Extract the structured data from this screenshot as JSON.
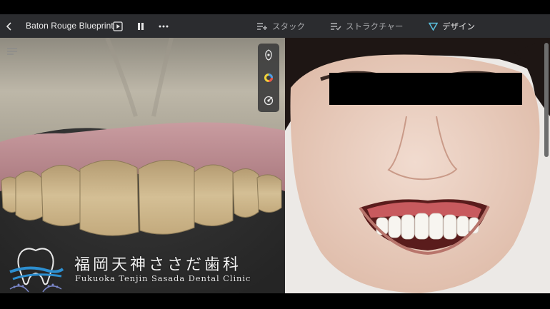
{
  "header": {
    "title": "Baton Rouge Blueprint",
    "back_icon": "chevron-left-icon",
    "play_icon": "play-square-icon",
    "pause_icon": "pause-icon",
    "more_icon": "more-horizontal-icon",
    "tabs": [
      {
        "label": "スタック",
        "icon": "stack-list-add-icon",
        "active": false
      },
      {
        "label": "ストラクチャー",
        "icon": "structure-list-check-icon",
        "active": false
      },
      {
        "label": "デザイン",
        "icon": "design-triangle-icon",
        "active": true
      }
    ]
  },
  "viewer": {
    "menu_icon": "menu-lines-icon",
    "tools": [
      "tooth-pin-icon",
      "color-palette-icon",
      "measure-target-icon"
    ]
  },
  "clinic": {
    "name_jp": "福岡天神ささだ歯科",
    "name_en": "Fukuoka Tenjin Sasada Dental Clinic"
  },
  "colors": {
    "appbar_bg": "#2b2c2f",
    "accent": "#5bc0de",
    "gum_model": "#c4959a",
    "teeth_model": "#cbb48a",
    "scan_upper": "#b8b2a4"
  }
}
